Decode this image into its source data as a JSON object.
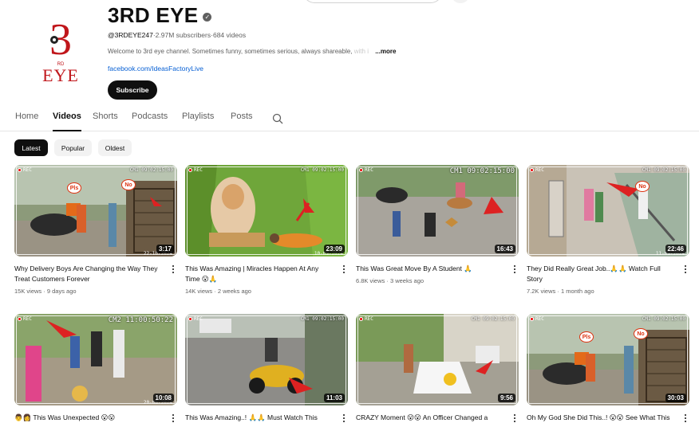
{
  "channel": {
    "name": "3RD EYE",
    "logo_text_top": "3",
    "logo_text_bottom": "EYE",
    "logo_small": "RD",
    "handle": "@3RDEYE247",
    "subscribers": "2.97M subscribers",
    "videos_count": "684 videos",
    "separator": " · ",
    "description": "Welcome to 3rd eye channel. Sometimes funny, sometimes serious, always shareable,",
    "description_fade": " with i",
    "more_label": "...more",
    "link": "facebook.com/IdeasFactoryLive",
    "subscribe_label": "Subscribe",
    "verified_icon": "check-circle-icon"
  },
  "tabs": [
    "Home",
    "Videos",
    "Shorts",
    "Podcasts",
    "Playlists",
    "Posts"
  ],
  "active_tab": "Videos",
  "chips": [
    "Latest",
    "Popular",
    "Oldest"
  ],
  "active_chip": "Latest",
  "videos": [
    {
      "title": "Why Delivery Boys Are Changing the Way They Treat Customers Forever",
      "views": "15K views",
      "age": "9 days ago",
      "duration": "3:17",
      "rec": "REC",
      "cam": "CM1  09:02:15:00",
      "bubble1": "Pls",
      "bubble2": "No",
      "stamp": "22-10-2024"
    },
    {
      "title": "This Was Amazing | Miracles Happen At Any Time 😮🙏",
      "views": "14K views",
      "age": "2 weeks ago",
      "duration": "23:09",
      "rec": "REC",
      "cam": "CM1  09:02:15:00",
      "stamp": "10-09-2024"
    },
    {
      "title": "This Was Great Move By A Student 🙏",
      "views": "6.8K views",
      "age": "3 weeks ago",
      "duration": "16:43",
      "rec": "REC",
      "cam": "CM1  09:02:15:00"
    },
    {
      "title": "They Did Really Great Job..🙏🙏 Watch Full Story",
      "views": "7.2K views",
      "age": "1 month ago",
      "duration": "22:46",
      "rec": "REC",
      "cam": "CM1  09:02:15:00",
      "bubble1": "No",
      "stamp": "11-09-2024"
    },
    {
      "title": "👨‍👩 This Was Unexpected 😮😮",
      "views": "",
      "age": "",
      "duration": "10:08",
      "rec": "REC",
      "cam": "CM2  11:00:50:22",
      "stamp": "20-08-2024"
    },
    {
      "title": "This Was Amazing..! 🙏🙏 Must Watch This",
      "views": "",
      "age": "",
      "duration": "11:03",
      "rec": "REC",
      "cam": "CM1  09:02:15:00"
    },
    {
      "title": "CRAZY Moment 😮😮 An Officer Changed a",
      "views": "",
      "age": "",
      "duration": "9:56",
      "rec": "REC",
      "cam": "CM1  09:02:15:00"
    },
    {
      "title": "Oh My God She Did This..! 😮😮 See What This",
      "views": "",
      "age": "",
      "duration": "30:03",
      "rec": "REC",
      "cam": "CM1  09:02:15:00",
      "bubble1": "Pls",
      "bubble2": "No"
    }
  ],
  "icons": {
    "search": "search-icon",
    "menu": "more-vert-icon",
    "rec": "record-dot-icon"
  }
}
